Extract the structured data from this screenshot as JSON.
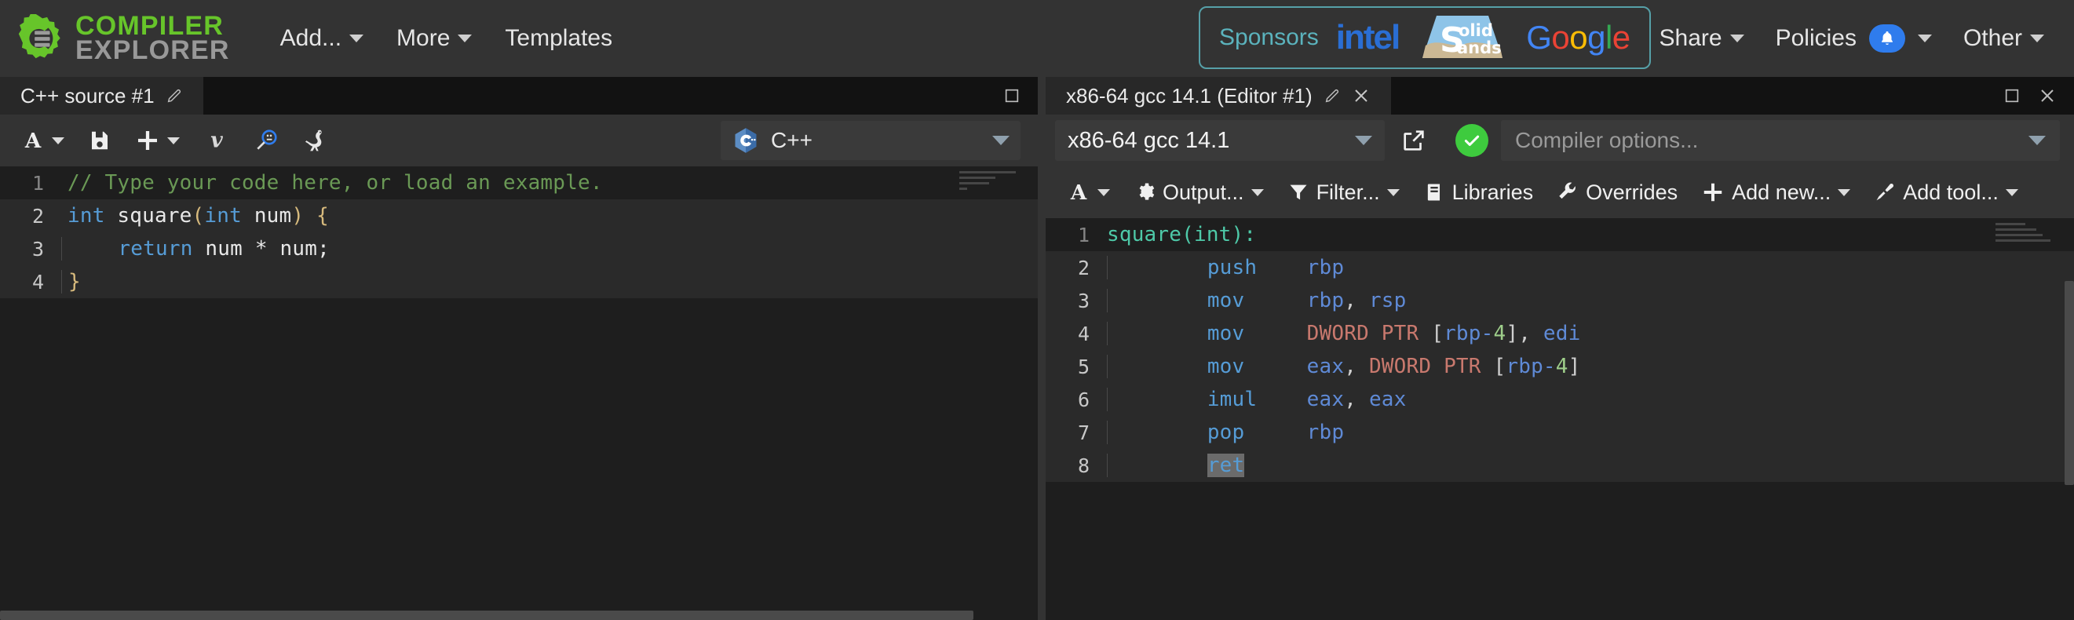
{
  "brand": {
    "line1": "COMPILER",
    "line2": "EXPLORER",
    "logo_icon": "gear-c-logo",
    "green": "#67c52a",
    "gray": "#999999"
  },
  "navbar": {
    "items": [
      {
        "label": "Add...",
        "has_caret": true
      },
      {
        "label": "More",
        "has_caret": true
      },
      {
        "label": "Templates",
        "has_caret": false
      }
    ],
    "right_items": [
      {
        "label": "Share",
        "has_caret": true,
        "badge": false
      },
      {
        "label": "Policies",
        "has_caret": true,
        "badge": true,
        "badge_icon": "bell-icon",
        "badge_color": "#2f7ced"
      },
      {
        "label": "Other",
        "has_caret": true,
        "badge": false
      }
    ],
    "sponsors": {
      "label": "Sponsors",
      "label_color": "#5bb3bd",
      "border_color": "#56a0a8",
      "logos": [
        {
          "name": "intel-logo",
          "text": "intel",
          "color": "#2a6ed4"
        },
        {
          "name": "solid-sands-logo",
          "text_top": "olid",
          "text_bottom": "ands",
          "initial": "S",
          "color_top": "#8ec4e8",
          "color_bottom": "#cbb894"
        },
        {
          "name": "google-logo",
          "letters": [
            "G",
            "o",
            "o",
            "g",
            "l",
            "e"
          ]
        }
      ]
    }
  },
  "editor_pane": {
    "tab": {
      "title": "C++ source #1",
      "edit_icon": "pencil-icon"
    },
    "window_controls": [
      {
        "name": "maximize-icon"
      }
    ],
    "toolbar": [
      {
        "name": "font-size-button",
        "icon": "letter-a-icon",
        "label": "",
        "caret": true
      },
      {
        "name": "save-button",
        "icon": "floppy-disk-icon",
        "label": "",
        "caret": false
      },
      {
        "name": "add-button",
        "icon": "plus-icon",
        "label": "",
        "caret": true
      },
      {
        "name": "vim-mode-button",
        "icon": "vim-icon",
        "label": "",
        "caret": false
      },
      {
        "name": "cpp-insights-button",
        "icon": "magnifier-cpp-icon",
        "label": "",
        "caret": false
      },
      {
        "name": "quick-bench-button",
        "icon": "ostrich-icon",
        "label": "",
        "caret": false
      }
    ],
    "language_select": {
      "value": "C++",
      "icon": "cpp-hexagon-icon"
    },
    "code": {
      "language": "cpp",
      "lines": [
        {
          "num": "1",
          "highlight": false,
          "tokens": [
            {
              "t": "// Type your code here, or load an example.",
              "c": "c-comment"
            }
          ]
        },
        {
          "num": "2",
          "highlight": true,
          "tokens": [
            {
              "t": "int",
              "c": "c-key"
            },
            {
              "t": " square",
              "c": "c-plain"
            },
            {
              "t": "(",
              "c": "c-brace"
            },
            {
              "t": "int",
              "c": "c-key"
            },
            {
              "t": " num",
              "c": "c-plain"
            },
            {
              "t": ")",
              "c": "c-brace"
            },
            {
              "t": " ",
              "c": "c-plain"
            },
            {
              "t": "{",
              "c": "c-brace"
            }
          ]
        },
        {
          "num": "3",
          "highlight": true,
          "tokens": [
            {
              "t": "    ",
              "c": "c-plain"
            },
            {
              "t": "return",
              "c": "c-key"
            },
            {
              "t": " num * num;",
              "c": "c-plain"
            }
          ]
        },
        {
          "num": "4",
          "highlight": true,
          "tokens": [
            {
              "t": "}",
              "c": "c-brace"
            }
          ]
        }
      ]
    }
  },
  "compiler_pane": {
    "tab": {
      "title": "x86-64 gcc 14.1 (Editor #1)",
      "edit_icon": "pencil-icon",
      "close_icon": "close-icon"
    },
    "window_controls": [
      {
        "name": "maximize-icon"
      },
      {
        "name": "close-icon"
      }
    ],
    "compiler_select": {
      "value": "x86-64 gcc 14.1"
    },
    "popout_icon": "external-link-icon",
    "status": {
      "icon": "check-circle-icon",
      "color": "#3ecb3e"
    },
    "options_input": {
      "value": "",
      "placeholder": "Compiler options..."
    },
    "toolbar": [
      {
        "name": "font-size-button",
        "icon": "letter-a-icon",
        "label": "",
        "caret": true
      },
      {
        "name": "output-button",
        "icon": "gear-icon",
        "label": "Output...",
        "caret": true
      },
      {
        "name": "filter-button",
        "icon": "funnel-icon",
        "label": "Filter...",
        "caret": true
      },
      {
        "name": "libraries-button",
        "icon": "book-icon",
        "label": "Libraries",
        "caret": false
      },
      {
        "name": "overrides-button",
        "icon": "wrench-icon",
        "label": "Overrides",
        "caret": false
      },
      {
        "name": "add-new-button",
        "icon": "plus-icon",
        "label": "Add new...",
        "caret": true
      },
      {
        "name": "add-tool-button",
        "icon": "screwdriver-icon",
        "label": "Add tool...",
        "caret": true
      }
    ],
    "asm": {
      "lines": [
        {
          "num": "1",
          "highlight": false,
          "tokens": [
            {
              "t": "square(int):",
              "c": "a-label"
            }
          ]
        },
        {
          "num": "2",
          "highlight": true,
          "tokens": [
            {
              "t": "        ",
              "c": "a-punc"
            },
            {
              "t": "push",
              "c": "a-mnem"
            },
            {
              "t": "    ",
              "c": "a-punc"
            },
            {
              "t": "rbp",
              "c": "a-reg"
            }
          ]
        },
        {
          "num": "3",
          "highlight": true,
          "tokens": [
            {
              "t": "        ",
              "c": "a-punc"
            },
            {
              "t": "mov",
              "c": "a-mnem"
            },
            {
              "t": "     ",
              "c": "a-punc"
            },
            {
              "t": "rbp",
              "c": "a-reg"
            },
            {
              "t": ",",
              "c": "a-punc"
            },
            {
              "t": " rsp",
              "c": "a-reg"
            }
          ]
        },
        {
          "num": "4",
          "highlight": true,
          "tokens": [
            {
              "t": "        ",
              "c": "a-punc"
            },
            {
              "t": "mov",
              "c": "a-mnem"
            },
            {
              "t": "     ",
              "c": "a-punc"
            },
            {
              "t": "DWORD PTR",
              "c": "a-type"
            },
            {
              "t": " [",
              "c": "a-punc"
            },
            {
              "t": "rbp-",
              "c": "a-reg"
            },
            {
              "t": "4",
              "c": "a-num"
            },
            {
              "t": "],",
              "c": "a-punc"
            },
            {
              "t": " edi",
              "c": "a-reg"
            }
          ]
        },
        {
          "num": "5",
          "highlight": true,
          "tokens": [
            {
              "t": "        ",
              "c": "a-punc"
            },
            {
              "t": "mov",
              "c": "a-mnem"
            },
            {
              "t": "     ",
              "c": "a-punc"
            },
            {
              "t": "eax",
              "c": "a-reg"
            },
            {
              "t": ", ",
              "c": "a-punc"
            },
            {
              "t": "DWORD PTR",
              "c": "a-type"
            },
            {
              "t": " [",
              "c": "a-punc"
            },
            {
              "t": "rbp-",
              "c": "a-reg"
            },
            {
              "t": "4",
              "c": "a-num"
            },
            {
              "t": "]",
              "c": "a-punc"
            }
          ]
        },
        {
          "num": "6",
          "highlight": true,
          "tokens": [
            {
              "t": "        ",
              "c": "a-punc"
            },
            {
              "t": "imul",
              "c": "a-mnem"
            },
            {
              "t": "    ",
              "c": "a-punc"
            },
            {
              "t": "eax",
              "c": "a-reg"
            },
            {
              "t": ",",
              "c": "a-punc"
            },
            {
              "t": " eax",
              "c": "a-reg"
            }
          ]
        },
        {
          "num": "7",
          "highlight": true,
          "tokens": [
            {
              "t": "        ",
              "c": "a-punc"
            },
            {
              "t": "pop",
              "c": "a-mnem"
            },
            {
              "t": "     ",
              "c": "a-punc"
            },
            {
              "t": "rbp",
              "c": "a-reg"
            }
          ]
        },
        {
          "num": "8",
          "highlight": true,
          "tokens": [
            {
              "t": "        ",
              "c": "a-punc"
            },
            {
              "t": "ret",
              "c": "a-mnem cursor-blk"
            }
          ]
        }
      ]
    }
  }
}
